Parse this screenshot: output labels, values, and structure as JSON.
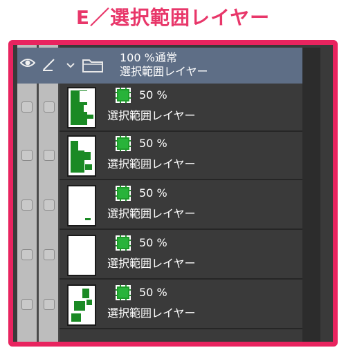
{
  "title": "E／選択範囲レイヤー",
  "colors": {
    "title": "#e8376a",
    "frame": "#e8245f",
    "panel_bg": "#3a3a3a",
    "folder_bg": "#5e6e86",
    "mask_green": "#1e9a2a"
  },
  "folder": {
    "opacity": "100 %通常",
    "name": "選択範囲レイヤー",
    "icons": [
      "eye-icon",
      "pen-icon",
      "chevron-down-icon",
      "folder-icon"
    ]
  },
  "layers": [
    {
      "opacity": "50 %",
      "name": "選択範囲レイヤー",
      "thumb": "thumb-a"
    },
    {
      "opacity": "50 %",
      "name": "選択範囲レイヤー",
      "thumb": "thumb-b"
    },
    {
      "opacity": "50 %",
      "name": "選択範囲レイヤー",
      "thumb": "thumb-c"
    },
    {
      "opacity": "50 %",
      "name": "選択範囲レイヤー",
      "thumb": "thumb-d"
    },
    {
      "opacity": "50 %",
      "name": "選択範囲レイヤー",
      "thumb": "thumb-e"
    }
  ]
}
